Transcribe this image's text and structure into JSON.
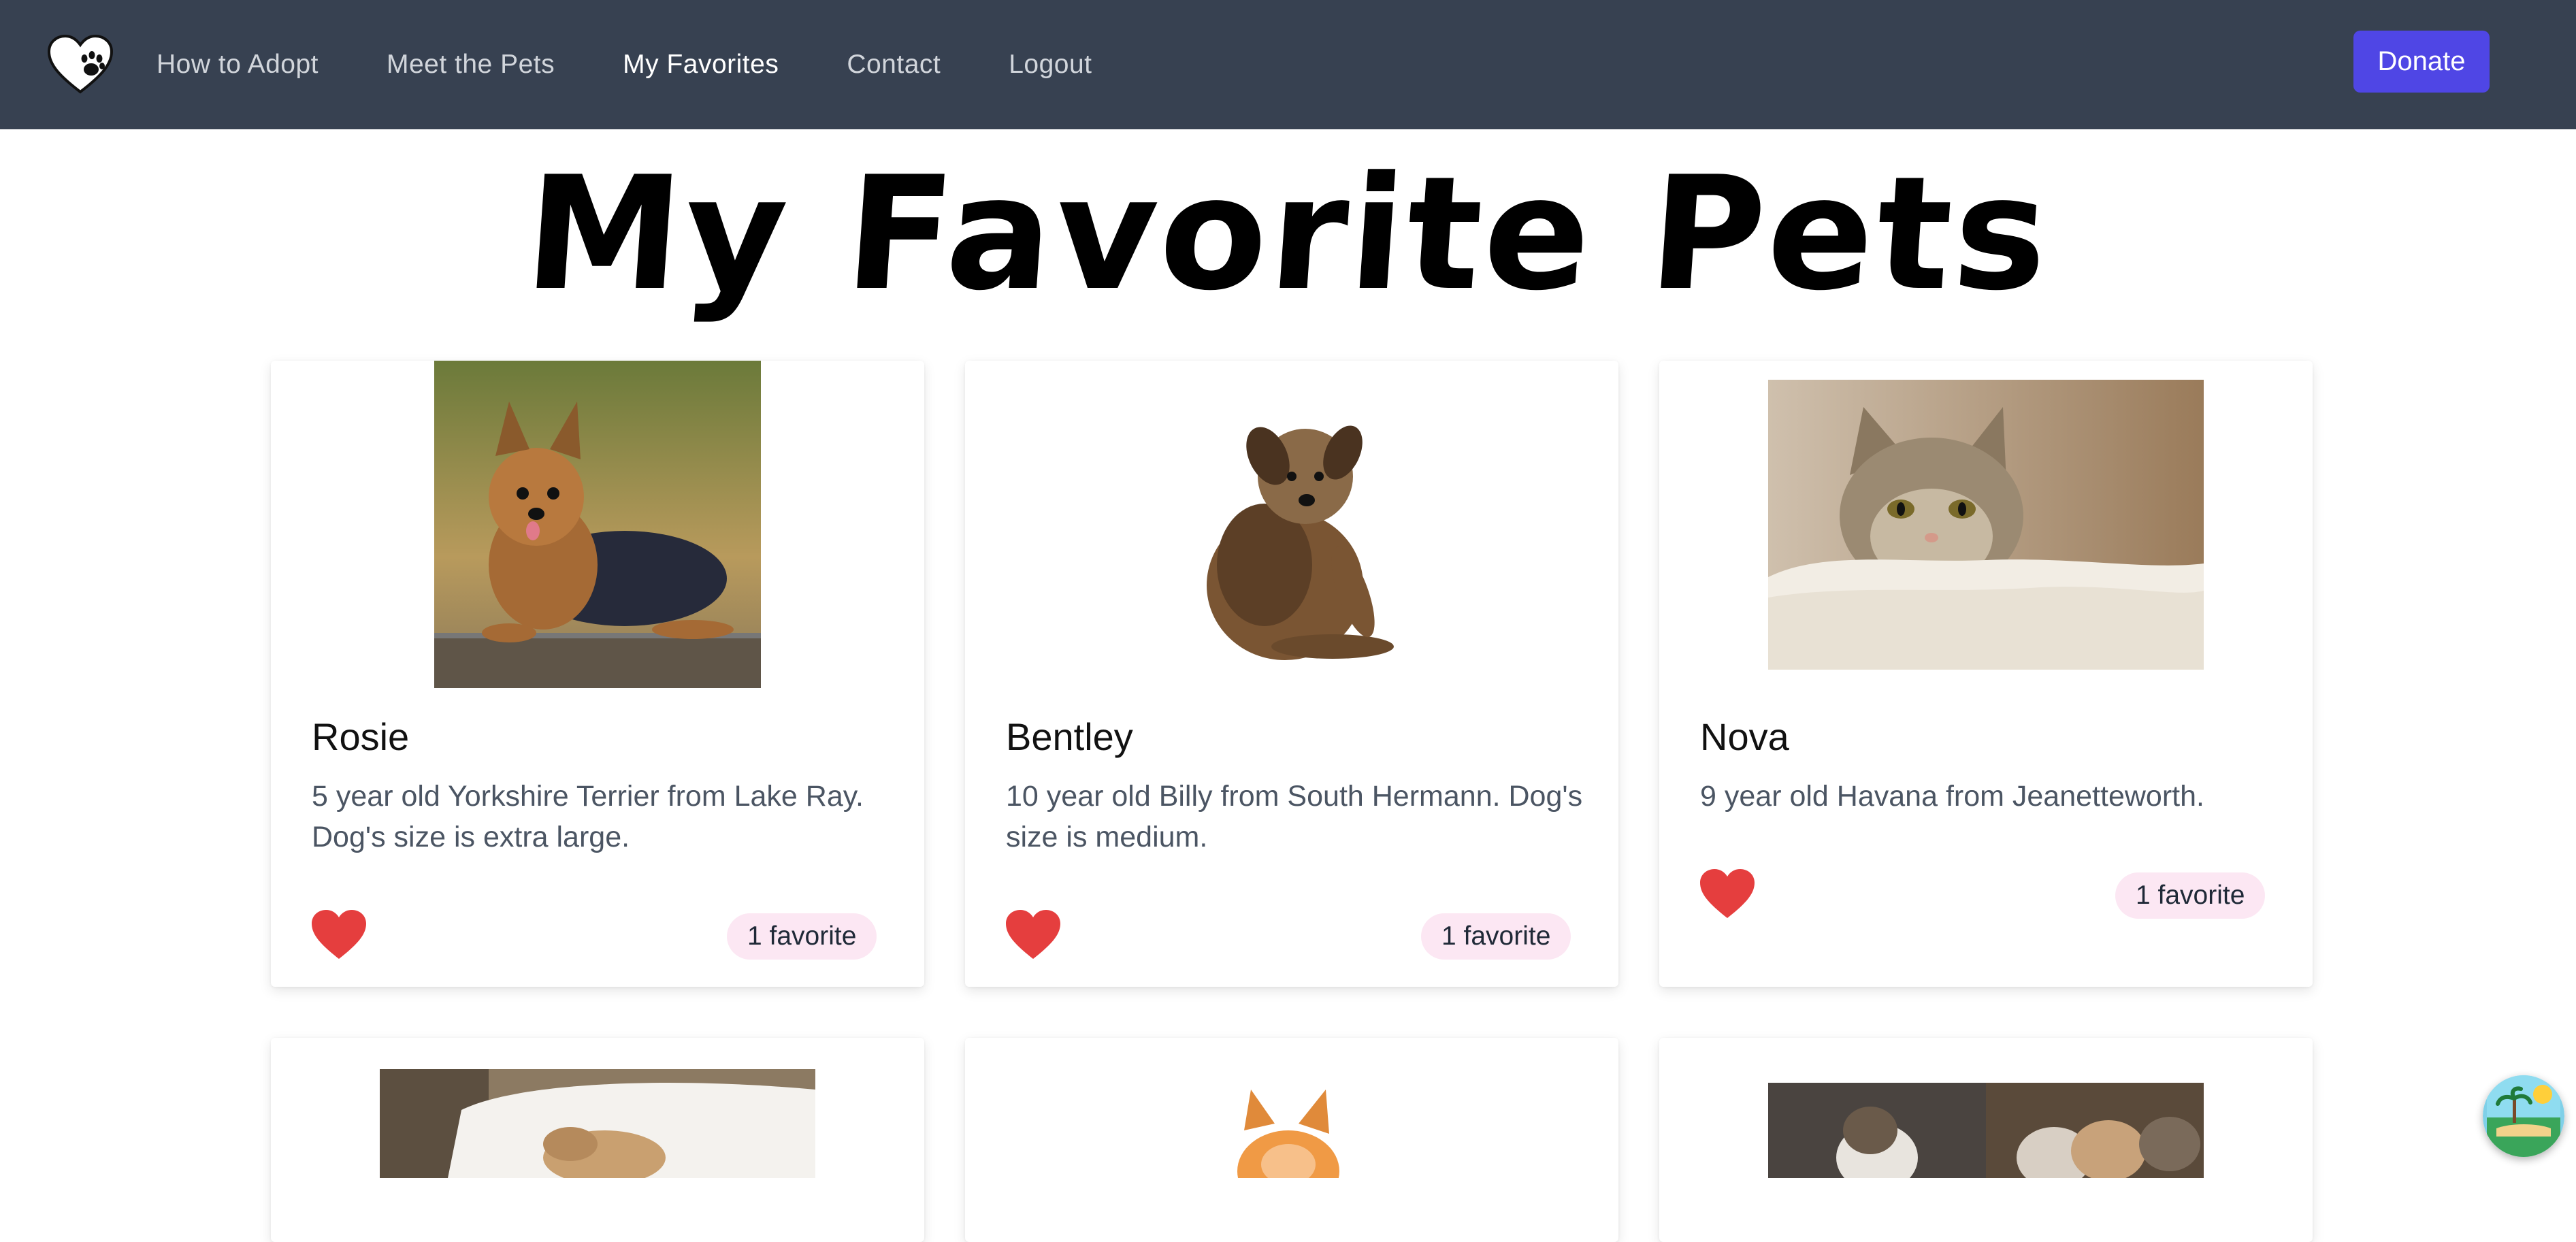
{
  "nav": {
    "links": [
      {
        "label": "How to Adopt"
      },
      {
        "label": "Meet the Pets"
      },
      {
        "label": "My Favorites"
      },
      {
        "label": "Contact"
      },
      {
        "label": "Logout"
      }
    ],
    "donate_label": "Donate"
  },
  "page": {
    "title": "My Favorite Pets"
  },
  "pets": [
    {
      "name": "Rosie",
      "description": "5 year old Yorkshire Terrier from Lake Ray. Dog's size is extra large.",
      "favorites": "1 favorite"
    },
    {
      "name": "Bentley",
      "description": "10 year old Billy from South Hermann. Dog's size is medium.",
      "favorites": "1 favorite"
    },
    {
      "name": "Nova",
      "description": "9 year old Havana from Jeanetteworth.",
      "favorites": "1 favorite"
    }
  ],
  "colors": {
    "navbar": "#374151",
    "accent": "#4f46e5",
    "heart": "#e53e3e",
    "badge": "#fce7f3"
  },
  "icons": [
    "paw-heart-logo-icon",
    "heart-icon",
    "beach-widget-icon"
  ]
}
